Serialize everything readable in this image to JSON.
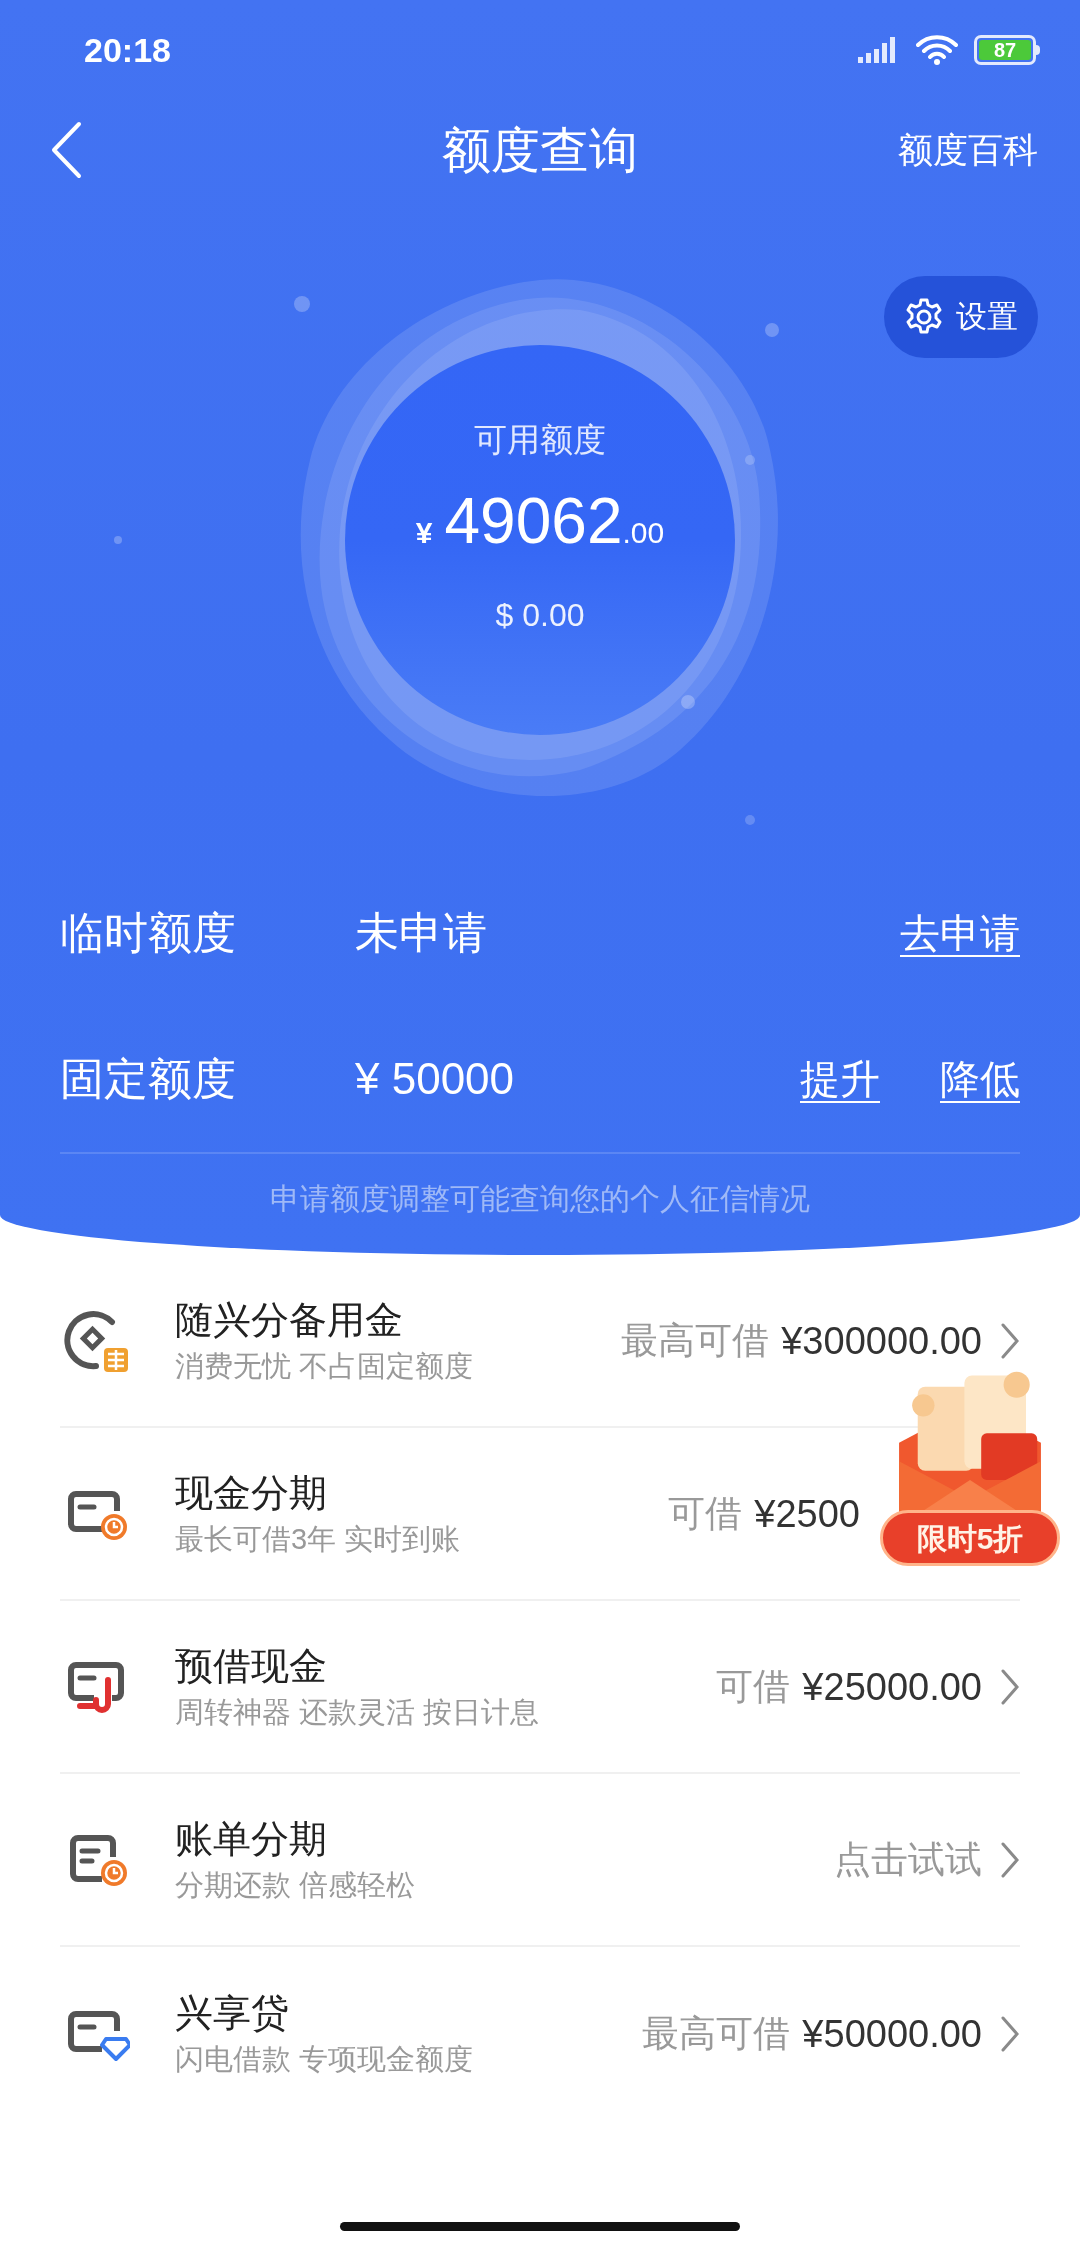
{
  "status_bar": {
    "time": "20:18",
    "battery": "87"
  },
  "nav": {
    "title": "额度查询",
    "action": "额度百科"
  },
  "settings_button": "设置",
  "available": {
    "label": "可用额度",
    "currency": "¥",
    "integer": "49062",
    "decimals": ".00",
    "usd": "$ 0.00"
  },
  "limits": [
    {
      "label": "临时额度",
      "value": "未申请",
      "links": [
        "去申请"
      ]
    },
    {
      "label": "固定额度",
      "value": "¥ 50000",
      "links": [
        "提升",
        "降低"
      ]
    }
  ],
  "notice": "申请额度调整可能查询您的个人征信情况",
  "products": [
    {
      "title": "随兴分备用金",
      "subtitle": "消费无忧 不占固定额度",
      "label": "最高可借",
      "amount": "¥300000.00",
      "chevron": true
    },
    {
      "title": "现金分期",
      "subtitle": "最长可借3年 实时到账",
      "label": "可借",
      "amount": "¥2500",
      "chevron": false
    },
    {
      "title": "预借现金",
      "subtitle": "周转神器 还款灵活 按日计息",
      "label": "可借",
      "amount": "¥25000.00",
      "chevron": true
    },
    {
      "title": "账单分期",
      "subtitle": "分期还款 倍感轻松",
      "label": "点击试试",
      "chevron": true
    },
    {
      "title": "兴享贷",
      "subtitle": "闪电借款 专项现金额度",
      "label": "最高可借",
      "amount": "¥50000.00",
      "chevron": true
    }
  ],
  "promo_badge": "限时5折"
}
